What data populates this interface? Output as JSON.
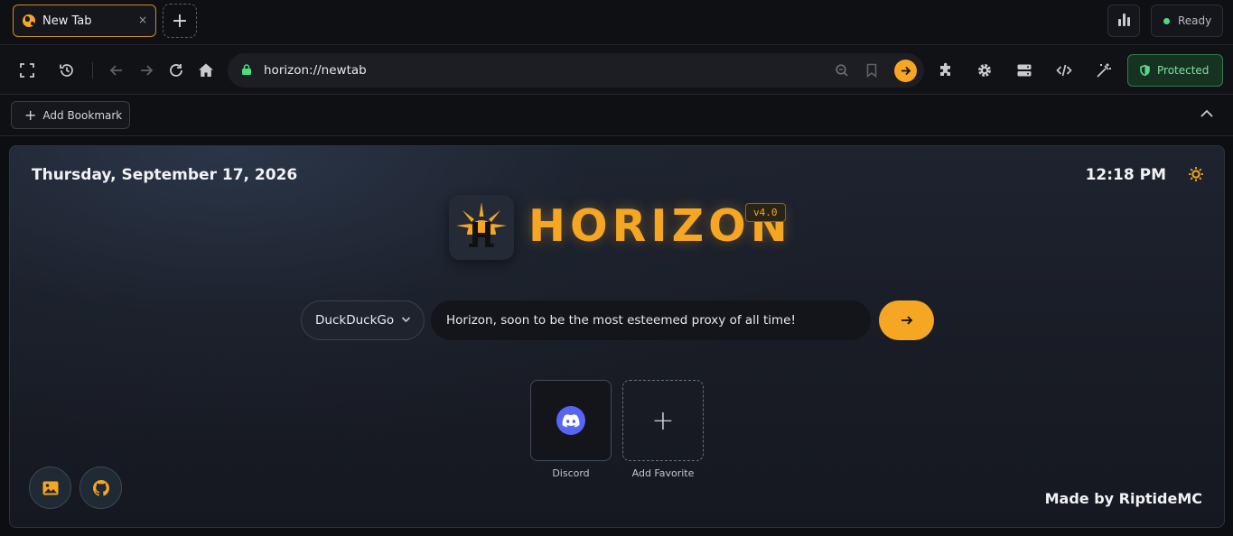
{
  "tabs": [
    {
      "title": "New Tab",
      "close": "×"
    }
  ],
  "new_tab_label": "+",
  "status": {
    "label": "Ready",
    "color": "#4ade80"
  },
  "address_bar": {
    "url": "horizon://newtab"
  },
  "security": {
    "label": "Protected"
  },
  "bookmarks_bar": {
    "add_label": "Add Bookmark"
  },
  "page": {
    "date": "Thursday, September 17, 2026",
    "time": "12:18 PM",
    "brand": "HORIZON",
    "version": "v4.0",
    "search_engine": "DuckDuckGo",
    "search_text": "Horizon, soon to be the most esteemed proxy of all time!",
    "favorites": [
      {
        "label": "Discord",
        "icon": "discord-icon"
      },
      {
        "label": "Add Favorite",
        "icon": "plus-icon"
      }
    ],
    "footer_credit": "Made by RiptideMC"
  },
  "colors": {
    "accent": "#f5a623",
    "protected": "#163322",
    "background": "#0d0e12"
  }
}
